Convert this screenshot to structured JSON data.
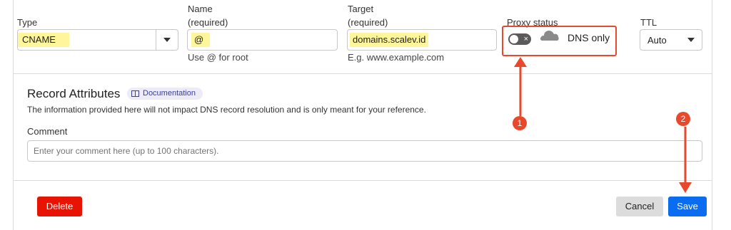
{
  "type_field": {
    "label": "Type",
    "value": "CNAME"
  },
  "name_field": {
    "label": "Name",
    "required_label": "(required)",
    "value": "@",
    "help": "Use @ for root"
  },
  "target_field": {
    "label": "Target",
    "required_label": "(required)",
    "value": "domains.scalev.id",
    "help": "E.g. www.example.com"
  },
  "proxy": {
    "label": "Proxy status",
    "toggle_mark": "×",
    "status_text": "DNS only",
    "toggle_on": false
  },
  "ttl_field": {
    "label": "TTL",
    "value": "Auto"
  },
  "record_attributes": {
    "heading": "Record Attributes",
    "doc_link": "Documentation",
    "description": "The information provided here will not impact DNS record resolution and is only meant for your reference.",
    "comment_label": "Comment",
    "comment_placeholder": "Enter your comment here (up to 100 characters)."
  },
  "buttons": {
    "delete": "Delete",
    "cancel": "Cancel",
    "save": "Save"
  },
  "annotations": {
    "step1": "1",
    "step2": "2"
  },
  "colors": {
    "highlight": "#fff59a",
    "annotation": "#e8482b",
    "delete": "#e81403",
    "save": "#0a6cf1",
    "cancel": "#dcdcdc"
  }
}
